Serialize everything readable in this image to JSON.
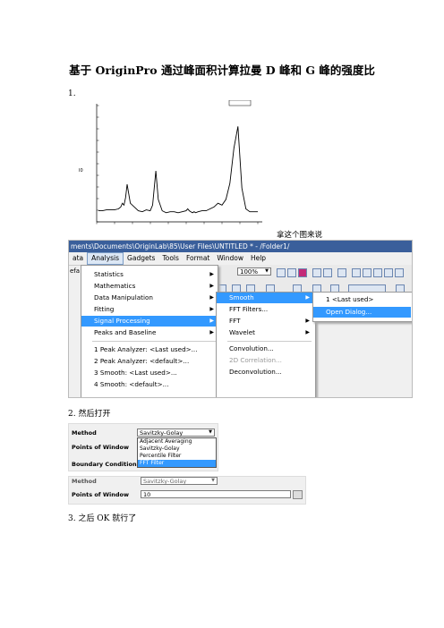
{
  "document": {
    "title": "基于 OriginPro 通过峰面积计算拉曼 D 峰和 G 峰的强度比",
    "step1": "1.",
    "caption": "拿这个图来说",
    "step2": "2. 然后打开",
    "step3": "3. 之后 OK 就行了"
  },
  "chart_data": {
    "type": "line",
    "title": "",
    "xlabel": "",
    "ylabel": "",
    "y_axis_mark": "I0",
    "series": [
      {
        "x": [
          0,
          5,
          10,
          15,
          20,
          25,
          28,
          30,
          32,
          34,
          36,
          38,
          40,
          45,
          50,
          55,
          60,
          65,
          68,
          70,
          72,
          75,
          80,
          85,
          90,
          95,
          100,
          105,
          110,
          112,
          114,
          116,
          118,
          120,
          122,
          125,
          130,
          135,
          140,
          145,
          150,
          155,
          160,
          165,
          170,
          175,
          180,
          185,
          190,
          200
        ],
        "y": [
          0.06,
          0.06,
          0.07,
          0.07,
          0.07,
          0.08,
          0.1,
          0.14,
          0.12,
          0.2,
          0.34,
          0.24,
          0.14,
          0.1,
          0.06,
          0.05,
          0.07,
          0.06,
          0.12,
          0.3,
          0.48,
          0.18,
          0.06,
          0.04,
          0.05,
          0.05,
          0.04,
          0.05,
          0.06,
          0.08,
          0.06,
          0.05,
          0.04,
          0.05,
          0.04,
          0.05,
          0.06,
          0.06,
          0.08,
          0.1,
          0.14,
          0.12,
          0.18,
          0.35,
          0.72,
          0.95,
          0.3,
          0.08,
          0.05,
          0.05
        ]
      }
    ]
  },
  "screenshot_menu": {
    "title_bar": "ments\\Documents\\OriginLab\\85\\User Files\\UNTITLED * - /Folder1/",
    "menubar": [
      "ata",
      "Analysis",
      "Gadgets",
      "Tools",
      "Format",
      "Window",
      "Help"
    ],
    "zoom_value": "100%",
    "left_stub": "efa",
    "analysis_items": [
      "Statistics",
      "Mathematics",
      "Data Manipulation",
      "Fitting",
      "Signal Processing",
      "Peaks and Baseline"
    ],
    "recent_items": [
      "1 Peak Analyzer: <Last used>...",
      "2 Peak Analyzer: <default>...",
      "3 Smooth: <Last used>...",
      "4 Smooth: <default>..."
    ],
    "signal_items": [
      "Smooth",
      "FFT Filters...",
      "FFT",
      "Wavelet",
      "Convolution...",
      "2D Correlation...",
      "Deconvolution..."
    ],
    "smooth_items": [
      "1 <Last used>",
      "Open Dialog..."
    ]
  },
  "dialog_method_list": {
    "method_label": "Method",
    "method_value": "Savitzky-Golay",
    "points_label": "Points of Window",
    "boundary_label": "Boundary Condition",
    "options": [
      "Adjacent Averaging",
      "Savitzky-Golay",
      "Percentile Filter",
      "FFT Filter"
    ],
    "highlighted_option": "FFT Filter"
  },
  "dialog_points": {
    "method_label": "Method",
    "method_value": "Savitzky-Golay",
    "points_label": "Points of Window",
    "points_value": "10"
  },
  "colors": {
    "highlight": "#3399ff",
    "title_bar": "#3a5f9b"
  }
}
